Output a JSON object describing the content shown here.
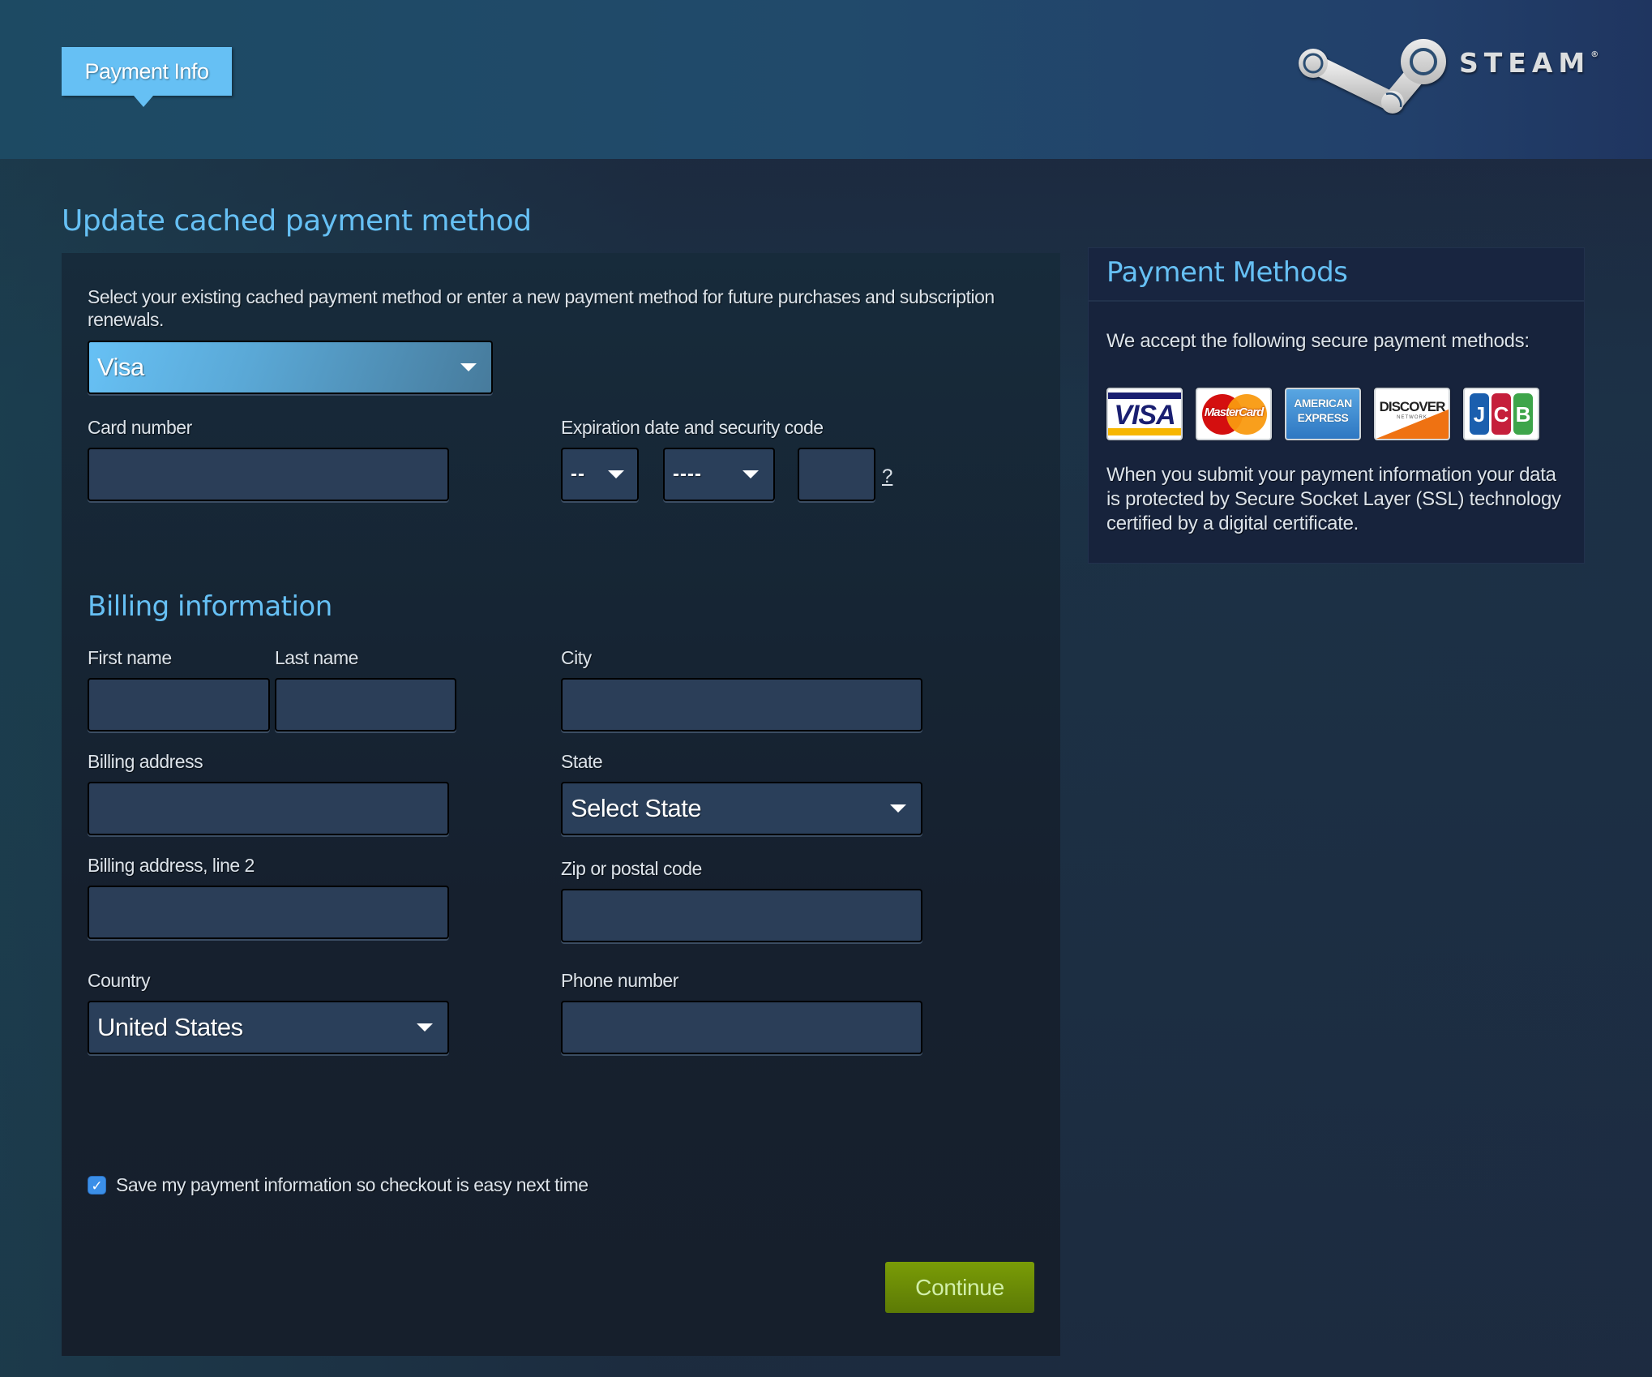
{
  "header": {
    "tab_label": "Payment Info",
    "brand": "STEAM",
    "brand_mark": "®"
  },
  "main": {
    "title": "Update cached payment method",
    "intro": "Select your existing cached payment method or enter a new payment method for future purchases and subscription renewals.",
    "payment_method_select": {
      "value": "Visa"
    },
    "card_number": {
      "label": "Card number",
      "value": ""
    },
    "expiration": {
      "label": "Expiration date and security code",
      "month": {
        "value": "--"
      },
      "year": {
        "value": "----"
      },
      "security_code": {
        "value": ""
      },
      "help_link": "?"
    },
    "billing": {
      "title": "Billing information",
      "first_name": {
        "label": "First name",
        "value": ""
      },
      "last_name": {
        "label": "Last name",
        "value": ""
      },
      "city": {
        "label": "City",
        "value": ""
      },
      "address": {
        "label": "Billing address",
        "value": ""
      },
      "state": {
        "label": "State",
        "value": "Select State"
      },
      "address2": {
        "label": "Billing address, line 2",
        "value": ""
      },
      "zip": {
        "label": "Zip or postal code",
        "value": ""
      },
      "country": {
        "label": "Country",
        "value": "United States"
      },
      "phone": {
        "label": "Phone number",
        "value": ""
      }
    },
    "save_info": {
      "label": "Save my payment information so checkout is easy next time",
      "checked": true,
      "check_glyph": "✓"
    },
    "continue_label": "Continue"
  },
  "sidebar": {
    "title": "Payment Methods",
    "accept_text": "We accept the following secure payment methods:",
    "cards": [
      {
        "name": "Visa",
        "text": "VISA"
      },
      {
        "name": "MasterCard",
        "text": "MasterCard"
      },
      {
        "name": "American Express",
        "line1": "AMERICAN",
        "line2": "EXPRESS"
      },
      {
        "name": "Discover",
        "text": "DISCOVER",
        "sub": "NETWORK"
      },
      {
        "name": "JCB",
        "letters": [
          "J",
          "C",
          "B"
        ]
      }
    ],
    "ssl_text": "When you submit your payment information your data is protected by Secure Socket Layer (SSL) technology certified by a digital certificate."
  },
  "colors": {
    "accent": "#66c0f4",
    "continue_green": "#6b8c06",
    "continue_text": "#d2efa9",
    "input_bg": "#2b3e58"
  }
}
